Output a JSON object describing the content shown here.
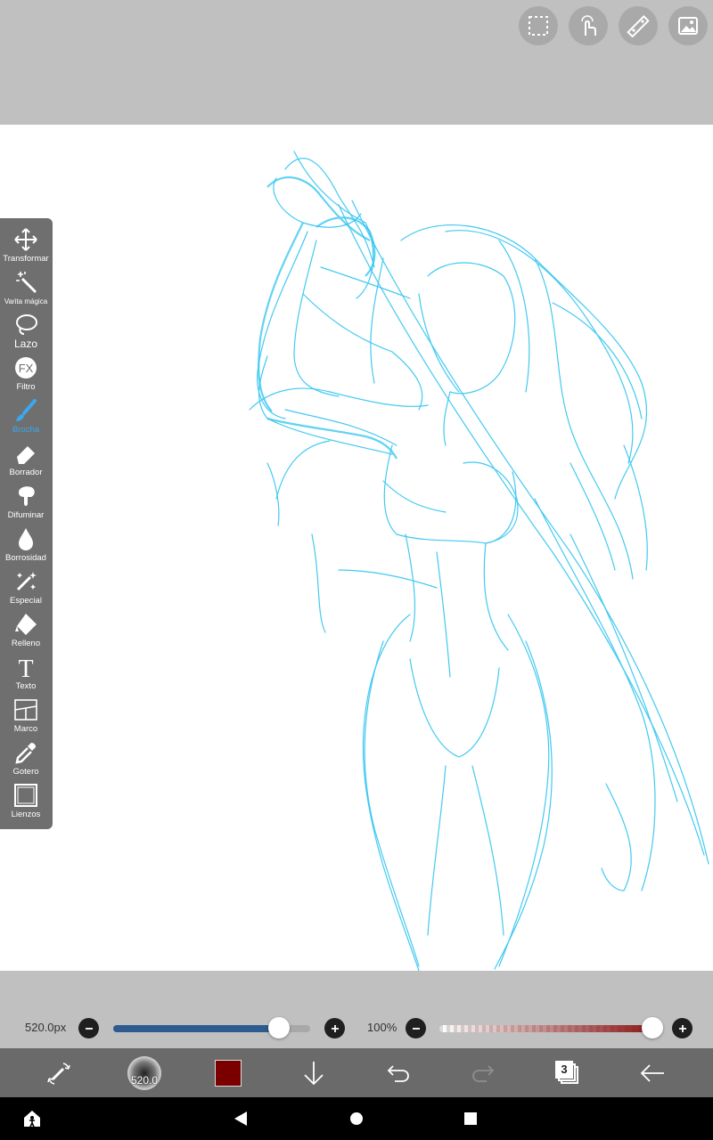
{
  "top_buttons": [
    {
      "icon": "selection-icon"
    },
    {
      "icon": "touch-icon"
    },
    {
      "icon": "ruler-icon"
    },
    {
      "icon": "material-icon"
    }
  ],
  "tools": [
    {
      "label": "Transformar",
      "icon": "move-icon"
    },
    {
      "label": "Varita mágica",
      "icon": "magic-wand-icon"
    },
    {
      "label": "Lazo",
      "icon": "lasso-icon"
    },
    {
      "label": "Filtro",
      "icon": "fx-icon",
      "icon_text": "FX"
    },
    {
      "label": "Brocha",
      "icon": "brush-icon",
      "active": true
    },
    {
      "label": "Borrador",
      "icon": "eraser-icon"
    },
    {
      "label": "Difuminar",
      "icon": "smudge-icon"
    },
    {
      "label": "Borrosidad",
      "icon": "blur-drop-icon"
    },
    {
      "label": "Especial",
      "icon": "special-icon"
    },
    {
      "label": "Relleno",
      "icon": "fill-icon"
    },
    {
      "label": "Texto",
      "icon": "text-icon",
      "icon_text": "T"
    },
    {
      "label": "Marco",
      "icon": "frame-icon"
    },
    {
      "label": "Gotero",
      "icon": "eyedropper-icon"
    },
    {
      "label": "Lienzos",
      "icon": "canvas-icon"
    }
  ],
  "brush_size": {
    "value_text": "520.0px",
    "fraction": 0.84
  },
  "opacity": {
    "value_text": "100%",
    "fraction": 1.0
  },
  "bottom": {
    "brush_preview_text": "520.0",
    "current_color": "#7a0000",
    "layer_count": "3"
  },
  "colors": {
    "accent": "#3aa8f0",
    "sketch": "#2ec4f0",
    "size_track": "#2e5b8f",
    "opacity_track": "#8b1a1a"
  }
}
